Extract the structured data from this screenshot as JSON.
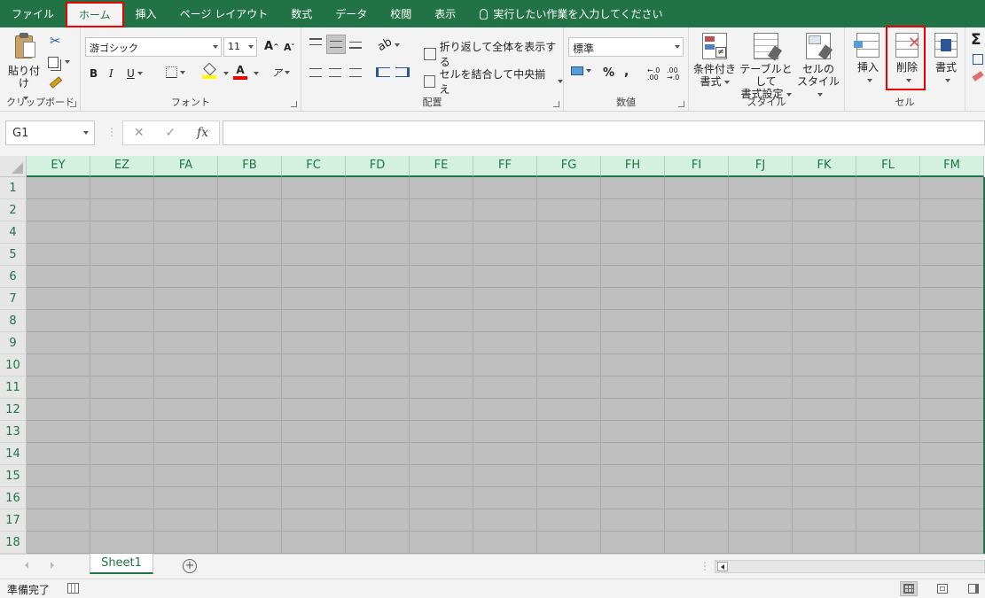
{
  "colors": {
    "excel_green": "#217346",
    "highlight_red": "#e00000",
    "cell_fill": "#bfbfbf"
  },
  "tabs": [
    {
      "label": "ファイル",
      "active": false
    },
    {
      "label": "ホーム",
      "active": true
    },
    {
      "label": "挿入",
      "active": false
    },
    {
      "label": "ページ レイアウト",
      "active": false
    },
    {
      "label": "数式",
      "active": false
    },
    {
      "label": "データ",
      "active": false
    },
    {
      "label": "校閲",
      "active": false
    },
    {
      "label": "表示",
      "active": false
    }
  ],
  "tell_me": "実行したい作業を入力してください",
  "ribbon": {
    "clipboard": {
      "label": "クリップボード",
      "paste": "貼り付け"
    },
    "font": {
      "label": "フォント",
      "font_name": "游ゴシック",
      "font_size": "11",
      "grow": "A",
      "shrink": "A",
      "bold": "B",
      "italic": "I",
      "underline": "U",
      "font_color": "A"
    },
    "alignment": {
      "label": "配置",
      "wrap_text": "折り返して全体を表示する",
      "merge_center": "セルを結合して中央揃え"
    },
    "number": {
      "label": "数値",
      "format": "標準",
      "percent": "%",
      "comma": ",",
      "inc_decimal": "←.0 .00",
      "dec_decimal": ".00 →.0"
    },
    "styles": {
      "label": "スタイル",
      "conditional_l1": "条件付き",
      "conditional_l2": "書式",
      "table_l1": "テーブルとして",
      "table_l2": "書式設定",
      "cell_l1": "セルの",
      "cell_l2": "スタイル"
    },
    "cells": {
      "label": "セル",
      "insert": "挿入",
      "delete": "削除",
      "format": "書式"
    },
    "editing": {
      "sum": "Σ"
    }
  },
  "formula_bar": {
    "name_box": "G1",
    "cancel": "✕",
    "enter": "✓",
    "fx": "fx",
    "formula": ""
  },
  "columns": [
    "EY",
    "EZ",
    "FA",
    "FB",
    "FC",
    "FD",
    "FE",
    "FF",
    "FG",
    "FH",
    "FI",
    "FJ",
    "FK",
    "FL",
    "FM"
  ],
  "rows": [
    "1",
    "2",
    "4",
    "5",
    "6",
    "7",
    "8",
    "9",
    "10",
    "11",
    "12",
    "13",
    "14",
    "15",
    "16",
    "17",
    "18"
  ],
  "sheets": [
    {
      "name": "Sheet1",
      "active": true
    }
  ],
  "add_sheet": "+",
  "status": {
    "ready": "準備完了"
  }
}
